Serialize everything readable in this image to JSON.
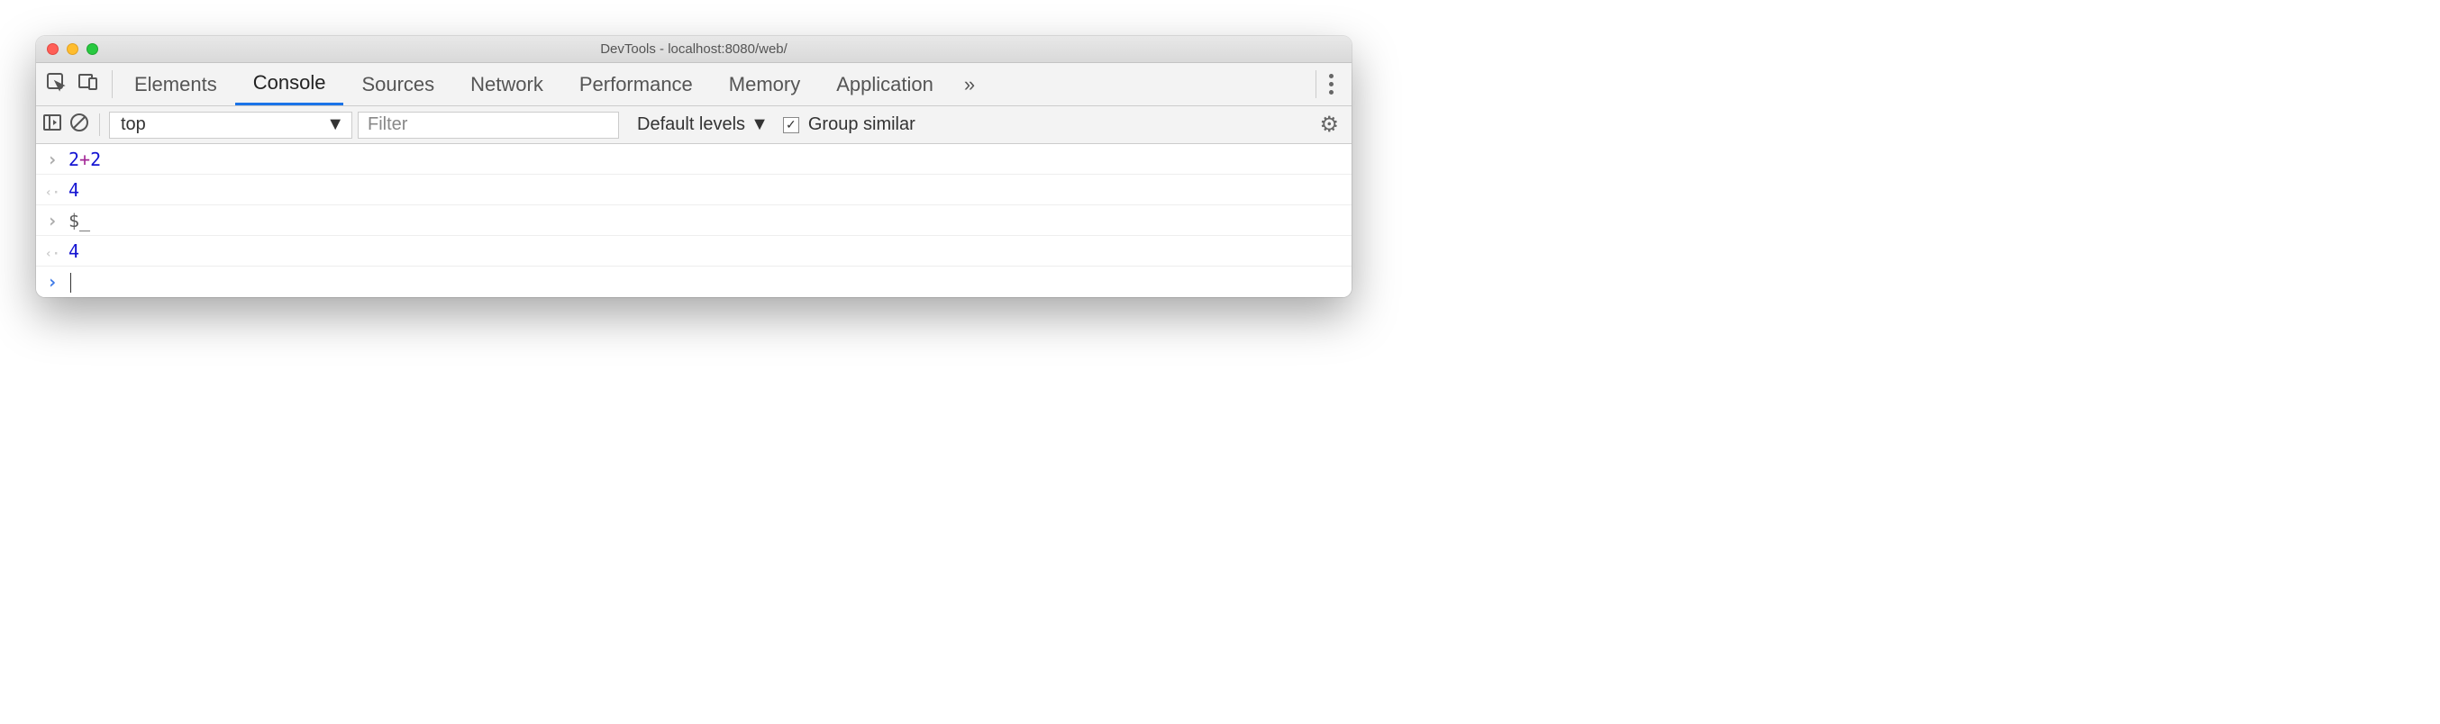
{
  "titlebar": {
    "title": "DevTools - localhost:8080/web/"
  },
  "tabs": {
    "items": [
      {
        "label": "Elements",
        "active": false
      },
      {
        "label": "Console",
        "active": true
      },
      {
        "label": "Sources",
        "active": false
      },
      {
        "label": "Network",
        "active": false
      },
      {
        "label": "Performance",
        "active": false
      },
      {
        "label": "Memory",
        "active": false
      },
      {
        "label": "Application",
        "active": false
      }
    ],
    "overflow_glyph": "»"
  },
  "toolbar": {
    "context_selected": "top",
    "filter_placeholder": "Filter",
    "levels_label": "Default levels",
    "group_similar_label": "Group similar",
    "group_similar_checked": true
  },
  "console": {
    "rows": [
      {
        "kind": "input",
        "tokens": [
          {
            "t": "2",
            "c": "num"
          },
          {
            "t": "+",
            "c": "op"
          },
          {
            "t": "2",
            "c": "num"
          }
        ]
      },
      {
        "kind": "output",
        "tokens": [
          {
            "t": "4",
            "c": "num"
          }
        ]
      },
      {
        "kind": "input",
        "tokens": [
          {
            "t": "$_",
            "c": "var"
          }
        ]
      },
      {
        "kind": "output",
        "tokens": [
          {
            "t": "4",
            "c": "num"
          }
        ]
      },
      {
        "kind": "prompt",
        "tokens": []
      }
    ]
  }
}
